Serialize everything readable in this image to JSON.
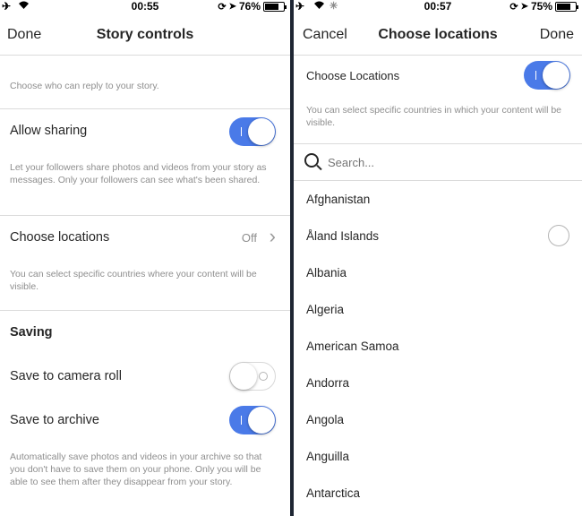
{
  "left": {
    "status": {
      "time": "00:55",
      "battery": "76%",
      "battery_level": 0.76
    },
    "nav": {
      "left": "Done",
      "title": "Story controls"
    },
    "reply_desc": "Choose who can reply to your story.",
    "allow_sharing": {
      "label": "Allow sharing",
      "on": true,
      "desc": "Let your followers share photos and videos from your story as messages. Only your followers can see what's been shared."
    },
    "choose_locations": {
      "label": "Choose locations",
      "value": "Off",
      "desc": "You can select specific countries where your content will be visible."
    },
    "saving": {
      "header": "Saving",
      "camera_roll": {
        "label": "Save to camera roll",
        "on": false
      },
      "archive": {
        "label": "Save to archive",
        "on": true
      },
      "desc": "Automatically save photos and videos in your archive so that you don't have to save them on your phone. Only you will be able to see them after they disappear from your story."
    }
  },
  "right": {
    "status": {
      "time": "00:57",
      "battery": "75%",
      "battery_level": 0.75
    },
    "nav": {
      "left": "Cancel",
      "title": "Choose locations",
      "right": "Done"
    },
    "choose_locations": {
      "label": "Choose Locations",
      "on": true,
      "desc": "You can select specific countries in which your content will be visible."
    },
    "search": {
      "placeholder": "Search..."
    },
    "countries": [
      "Afghanistan",
      "Åland Islands",
      "Albania",
      "Algeria",
      "American Samoa",
      "Andorra",
      "Angola",
      "Anguilla",
      "Antarctica"
    ]
  },
  "colors": {
    "accent": "#4a7ae8",
    "divider": "#dbdbdb",
    "muted": "#8e8e8e",
    "text": "#262626"
  },
  "icons": {
    "airplane": "✈",
    "wifi": "wifi-icon",
    "location": "➤",
    "chevron": "›"
  }
}
